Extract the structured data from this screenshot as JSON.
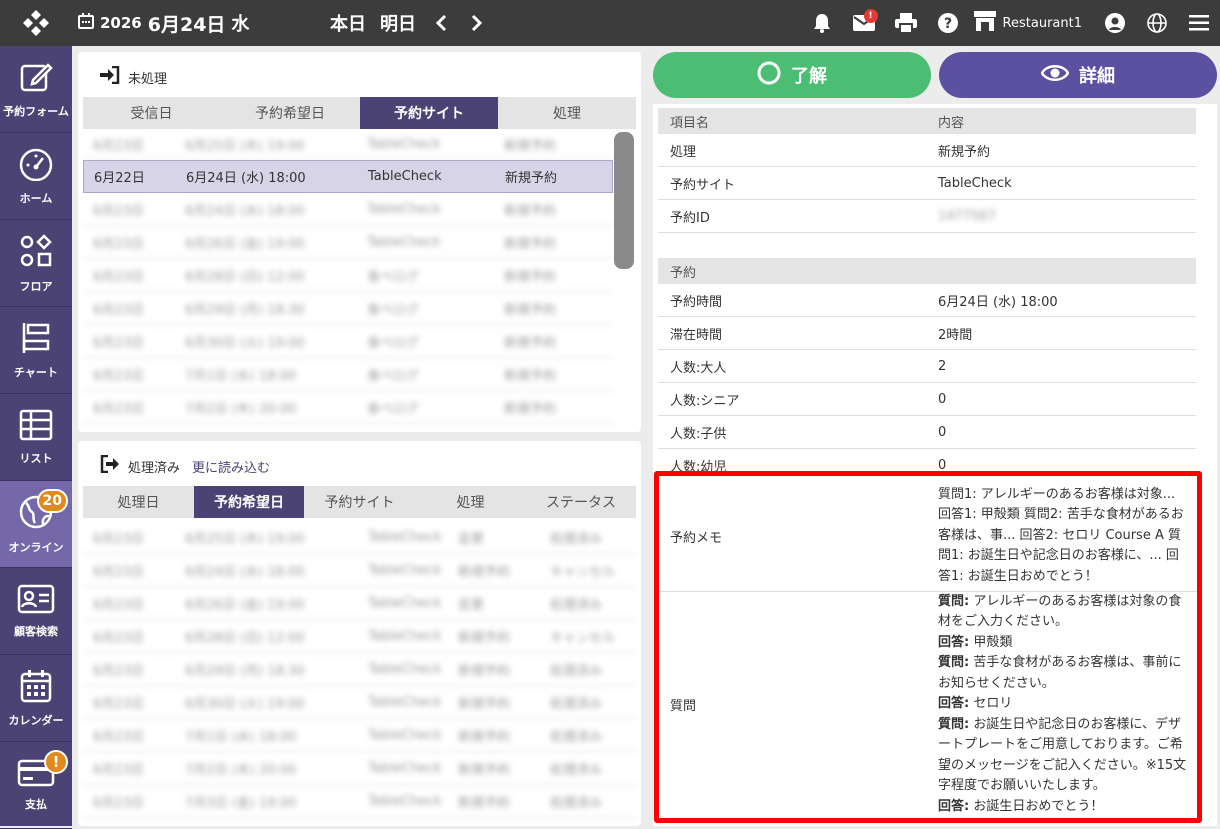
{
  "header": {
    "year": "2026",
    "monthday": "6月24日",
    "weekday": "水",
    "today": "本日",
    "tomorrow": "明日",
    "mail_badge": "!",
    "restaurant": "Restaurant1"
  },
  "sidebar": {
    "items": [
      {
        "label": "予約フォーム",
        "icon": "edit-icon"
      },
      {
        "label": "ホーム",
        "icon": "gauge-icon"
      },
      {
        "label": "フロア",
        "icon": "shapes-icon"
      },
      {
        "label": "チャート",
        "icon": "chart-icon"
      },
      {
        "label": "リスト",
        "icon": "list-icon"
      },
      {
        "label": "オンライン",
        "icon": "globe-icon",
        "badge": "20"
      },
      {
        "label": "顧客検索",
        "icon": "id-card-icon"
      },
      {
        "label": "カレンダー",
        "icon": "calendar-icon"
      },
      {
        "label": "支払",
        "icon": "credit-card-icon",
        "badge": "!"
      }
    ]
  },
  "pending": {
    "title": "未処理",
    "columns": [
      "受信日",
      "予約希望日",
      "予約サイト",
      "処理"
    ],
    "selected_row": {
      "received": "6月22日",
      "date": "6月24日 (水) 18:00",
      "site": "TableCheck",
      "action": "新規予約"
    }
  },
  "processed": {
    "title": "処理済み",
    "reload": "更に読み込む",
    "columns": [
      "処理日",
      "予約希望日",
      "予約サイト",
      "処理",
      "ステータス"
    ]
  },
  "actions": {
    "ok": "了解",
    "detail": "詳細"
  },
  "detail": {
    "header": {
      "key": "項目名",
      "value": "内容"
    },
    "rows1": [
      {
        "key": "処理",
        "value": "新規予約"
      },
      {
        "key": "予約サイト",
        "value": "TableCheck"
      },
      {
        "key": "予約ID",
        "value": "1477567"
      }
    ],
    "section": "予約",
    "rows2": [
      {
        "key": "予約時間",
        "value": "6月24日 (水) 18:00"
      },
      {
        "key": "滞在時間",
        "value": "2時間"
      },
      {
        "key": "人数:大人",
        "value": "2"
      },
      {
        "key": "人数:シニア",
        "value": "0"
      },
      {
        "key": "人数:子供",
        "value": "0"
      },
      {
        "key": "人数:幼児",
        "value": "0"
      }
    ],
    "memo_label": "予約メモ",
    "memo": "質問1: アレルギーのあるお客様は対象... 回答1: 甲殻類 質問2: 苦手な食材があるお客様は、事... 回答2: セロリ Course A 質問1: お誕生日や記念日のお客様に、... 回答1: お誕生日おめでとう！",
    "question_label": "質問",
    "qa": [
      {
        "label": "質問:",
        "text": " アレルギーのあるお客様は対象の食材をご入力ください。"
      },
      {
        "label": "回答:",
        "text": " 甲殻類"
      },
      {
        "label": "質問:",
        "text": " 苦手な食材があるお客様は、事前にお知らせください。"
      },
      {
        "label": "回答:",
        "text": " セロリ"
      },
      {
        "label": "質問:",
        "text": " お誕生日や記念日のお客様に、デザートプレートをご用意しております。ご希望のメッセージをご記入ください。※15文字程度でお願いいたします。"
      },
      {
        "label": "回答:",
        "text": " お誕生日おめでとう！"
      }
    ]
  }
}
